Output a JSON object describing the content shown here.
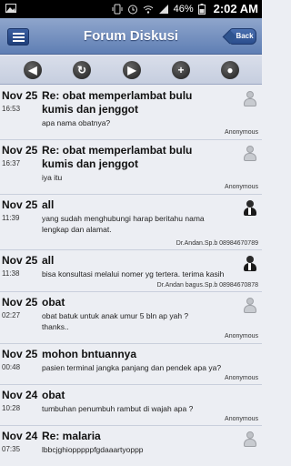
{
  "status_bar": {
    "battery": "46%",
    "time": "2:02 AM"
  },
  "header": {
    "title": "Forum Diskusi",
    "back_label": "Back"
  },
  "toolbar": {
    "icons": [
      "arrow-left-icon",
      "refresh-icon",
      "arrow-right-icon",
      "add-icon",
      "user-icon"
    ]
  },
  "posts": [
    {
      "date": "Nov 25",
      "time": "16:53",
      "title": "Re: obat memperlambat bulu kumis dan jenggot",
      "body": "apa nama obatnya?",
      "author": "Anonymous",
      "avatar": "grey"
    },
    {
      "date": "Nov 25",
      "time": "16:37",
      "title": "Re: obat memperlambat bulu kumis dan jenggot",
      "body": "iya itu",
      "author": "Anonymous",
      "avatar": "grey"
    },
    {
      "date": "Nov 25",
      "time": "11:39",
      "title": "all",
      "body": "yang sudah menghubungi harap beritahu nama lengkap dan alamat.",
      "author": "Dr.Andan.Sp.b 08984670789",
      "avatar": "doc"
    },
    {
      "date": "Nov 25",
      "time": "11:38",
      "title": "all",
      "body": "bisa konsultasi melalui nomer yg tertera. terima kasih",
      "author": "Dr.Andan bagus.Sp.b 08984670878",
      "avatar": "doc"
    },
    {
      "date": "Nov 25",
      "time": "02:27",
      "title": "obat",
      "body": "obat batuk untuk anak umur 5 bln ap yah ? thanks..",
      "author": "Anonymous",
      "avatar": "grey"
    },
    {
      "date": "Nov 25",
      "time": "00:48",
      "title": "mohon bntuannya",
      "body": "pasien terminal jangka panjang dan pendek apa ya?",
      "author": "Anonymous",
      "avatar": "grey"
    },
    {
      "date": "Nov 24",
      "time": "10:28",
      "title": "obat",
      "body": "tumbuhan penumbuh rambut di wajah apa ?",
      "author": "Anonymous",
      "avatar": "grey"
    },
    {
      "date": "Nov 24",
      "time": "07:35",
      "title": "Re: malaria",
      "body": "lbbcjghiopppppfgdaaartyoppp",
      "author": "",
      "avatar": "grey"
    }
  ]
}
